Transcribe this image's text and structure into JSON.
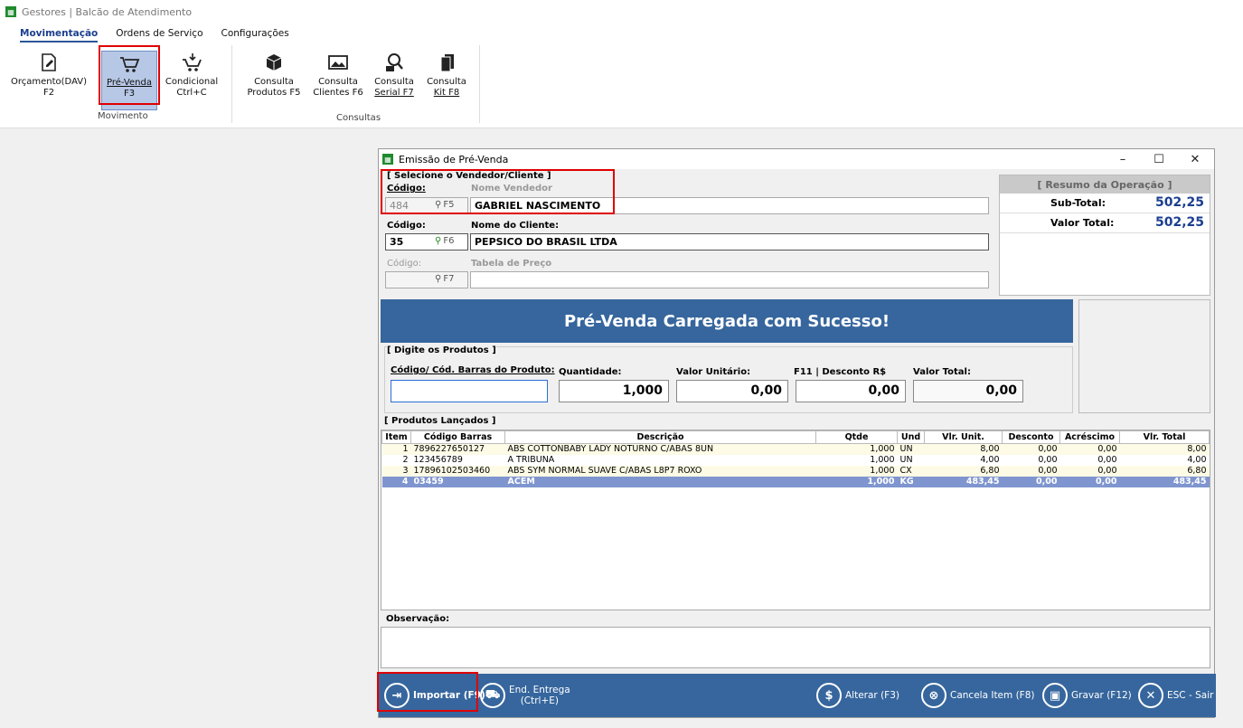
{
  "app": {
    "title": "Gestores | Balcão de Atendimento"
  },
  "ribbon": {
    "tabs": [
      "Movimentação",
      "Ordens de Serviço",
      "Configurações"
    ],
    "buttons": {
      "orcamento": {
        "line1": "Orçamento(DAV)",
        "line2": "F2"
      },
      "prevenda": {
        "line1": "Pré-Venda",
        "line2": "F3"
      },
      "condicional": {
        "line1": "Condicional",
        "line2": "Ctrl+C"
      },
      "consulta_produtos": {
        "line1": "Consulta",
        "line2": "Produtos F5"
      },
      "consulta_clientes": {
        "line1": "Consulta",
        "line2": "Clientes F6"
      },
      "consulta_serial": {
        "line1": "Consulta",
        "line2": "Serial F7"
      },
      "consulta_kit": {
        "line1": "Consulta",
        "line2": "Kit F8"
      }
    },
    "groups": {
      "movimento": "Movimento",
      "consultas": "Consultas"
    }
  },
  "window": {
    "title": "Emissão de Pré-Venda",
    "ctrl_min": "–",
    "ctrl_max": "☐",
    "ctrl_close": "✕"
  },
  "vendedor": {
    "section": "[ Selecione o Vendedor/Cliente ]",
    "codigo_label": "Código:",
    "nome_label": "Nome Vendedor",
    "codigo": "484",
    "fkey": "F5",
    "nome": "GABRIEL NASCIMENTO"
  },
  "cliente": {
    "codigo_label": "Código:",
    "nome_label": "Nome do Cliente:",
    "codigo": "35",
    "fkey": "F6",
    "nome": "PEPSICO DO BRASIL LTDA"
  },
  "tabela": {
    "codigo_label": "Código:",
    "nome_label": "Tabela de Preço",
    "codigo": "",
    "fkey": "F7",
    "nome": ""
  },
  "resumo": {
    "title": "[ Resumo da Operação ]",
    "subtotal_label": "Sub-Total:",
    "subtotal": "502,25",
    "total_label": "Valor Total:",
    "total": "502,25"
  },
  "banner": {
    "message": "Pré-Venda Carregada com Sucesso!"
  },
  "produtos_input": {
    "section": "[ Digite os Produtos ]",
    "codigo_label": "Código/ Cód. Barras do Produto:",
    "qtd_label": "Quantidade:",
    "unit_label": "Valor Unitário:",
    "desc_label": "F11 | Desconto R$",
    "total_label": "Valor Total:",
    "codigo": "",
    "qtd": "1,000",
    "unit": "0,00",
    "desc": "0,00",
    "total": "0,00"
  },
  "grid": {
    "section": "[ Produtos Lançados ]",
    "headers": [
      "Item",
      "Código Barras",
      "Descrição",
      "Qtde",
      "Und",
      "Vlr. Unit.",
      "Desconto",
      "Acréscimo",
      "Vlr. Total"
    ],
    "rows": [
      [
        "1",
        "7896227650127",
        "ABS COTTONBABY LADY NOTURNO C/ABAS 8UN",
        "1,000",
        "UN",
        "8,00",
        "0,00",
        "0,00",
        "8,00"
      ],
      [
        "2",
        "123456789",
        "A TRIBUNA",
        "1,000",
        "UN",
        "4,00",
        "0,00",
        "0,00",
        "4,00"
      ],
      [
        "3",
        "17896102503460",
        "ABS SYM NORMAL SUAVE C/ABAS L8P7 ROXO",
        "1,000",
        "CX",
        "6,80",
        "0,00",
        "0,00",
        "6,80"
      ],
      [
        "4",
        "03459",
        "ACEM",
        "1,000",
        "KG",
        "483,45",
        "0,00",
        "0,00",
        "483,45"
      ]
    ]
  },
  "observacao": {
    "label": "Observação:",
    "value": ""
  },
  "bottom": {
    "importar": "Importar (F9)",
    "end_entrega_1": "End. Entrega",
    "end_entrega_2": "(Ctrl+E)",
    "alterar": "Alterar (F3)",
    "cancela": "Cancela Item (F8)",
    "gravar": "Gravar (F12)",
    "sair": "ESC - Sair"
  },
  "colors": {
    "accent": "#36669d",
    "highlight": "#e00000",
    "selected_row": "#7f95cf"
  }
}
